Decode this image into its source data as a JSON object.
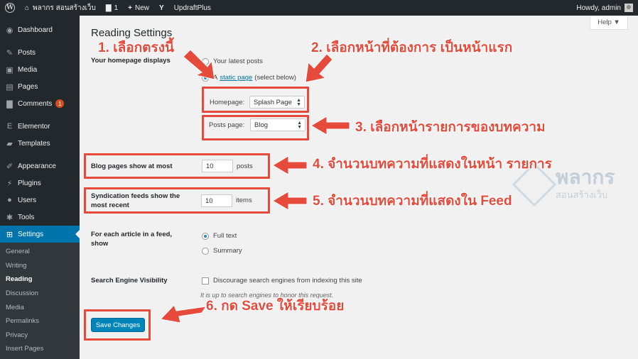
{
  "admin_bar": {
    "site_name": "พลากร สอนสร้างเว็บ",
    "comments_count": "1",
    "new_label": "New",
    "updraft_label": "UpdraftPlus",
    "howdy": "Howdy, admin"
  },
  "sidebar": {
    "items": [
      {
        "label": "Dashboard",
        "icon": "dashboard-icon"
      },
      {
        "label": "Posts",
        "icon": "pin-icon"
      },
      {
        "label": "Media",
        "icon": "media-icon"
      },
      {
        "label": "Pages",
        "icon": "pages-icon"
      },
      {
        "label": "Comments",
        "icon": "comment-icon",
        "badge": "1"
      },
      {
        "label": "Elementor",
        "icon": "elementor-icon"
      },
      {
        "label": "Templates",
        "icon": "folder-icon"
      },
      {
        "label": "Appearance",
        "icon": "brush-icon"
      },
      {
        "label": "Plugins",
        "icon": "plugin-icon"
      },
      {
        "label": "Users",
        "icon": "users-icon"
      },
      {
        "label": "Tools",
        "icon": "wrench-icon"
      },
      {
        "label": "Settings",
        "icon": "settings-icon",
        "active": true
      }
    ],
    "submenu": [
      "General",
      "Writing",
      "Reading",
      "Discussion",
      "Media",
      "Permalinks",
      "Privacy",
      "Insert Pages"
    ],
    "current_submenu": "Reading"
  },
  "help_label": "Help ▼",
  "page_title": "Reading Settings",
  "homepage": {
    "label": "Your homepage displays",
    "option_latest": "Your latest posts",
    "option_static_prefix": "A",
    "option_static_link": "static page",
    "option_static_suffix": "(select below)",
    "homepage_label": "Homepage:",
    "homepage_value": "Splash Page",
    "posts_page_label": "Posts page:",
    "posts_page_value": "Blog"
  },
  "blog_pages": {
    "label": "Blog pages show at most",
    "value": "10",
    "suffix": "posts"
  },
  "syndication": {
    "label_line1": "Syndication feeds show the",
    "label_line2": "most recent",
    "value": "10",
    "suffix": "items"
  },
  "feed_article": {
    "label_line1": "For each article in a feed,",
    "label_line2": "show",
    "option_full": "Full text",
    "option_summary": "Summary"
  },
  "search_visibility": {
    "label": "Search Engine Visibility",
    "option": "Discourage search engines from indexing this site",
    "description": "It is up to search engines to honor this request."
  },
  "save_label": "Save Changes",
  "annotations": {
    "a1": "1. เลือกตรงนี้",
    "a2": "2. เลือกหน้าที่ต้องการ เป็นหน้าแรก",
    "a3": "3. เลือกหน้ารายการของบทความ",
    "a4": "4. จำนวนบทความที่แสดงในหน้า รายการ",
    "a5": "5. จำนวนบทความที่แสดงใน Feed",
    "a6": "6. กด Save ให้เรียบร้อย"
  },
  "watermark": {
    "main": "พลากร",
    "sub": "สอนสร้างเว็บ"
  },
  "colors": {
    "accent": "#0073aa",
    "annotation": "#e64a3a",
    "admin_bg": "#23282d"
  }
}
